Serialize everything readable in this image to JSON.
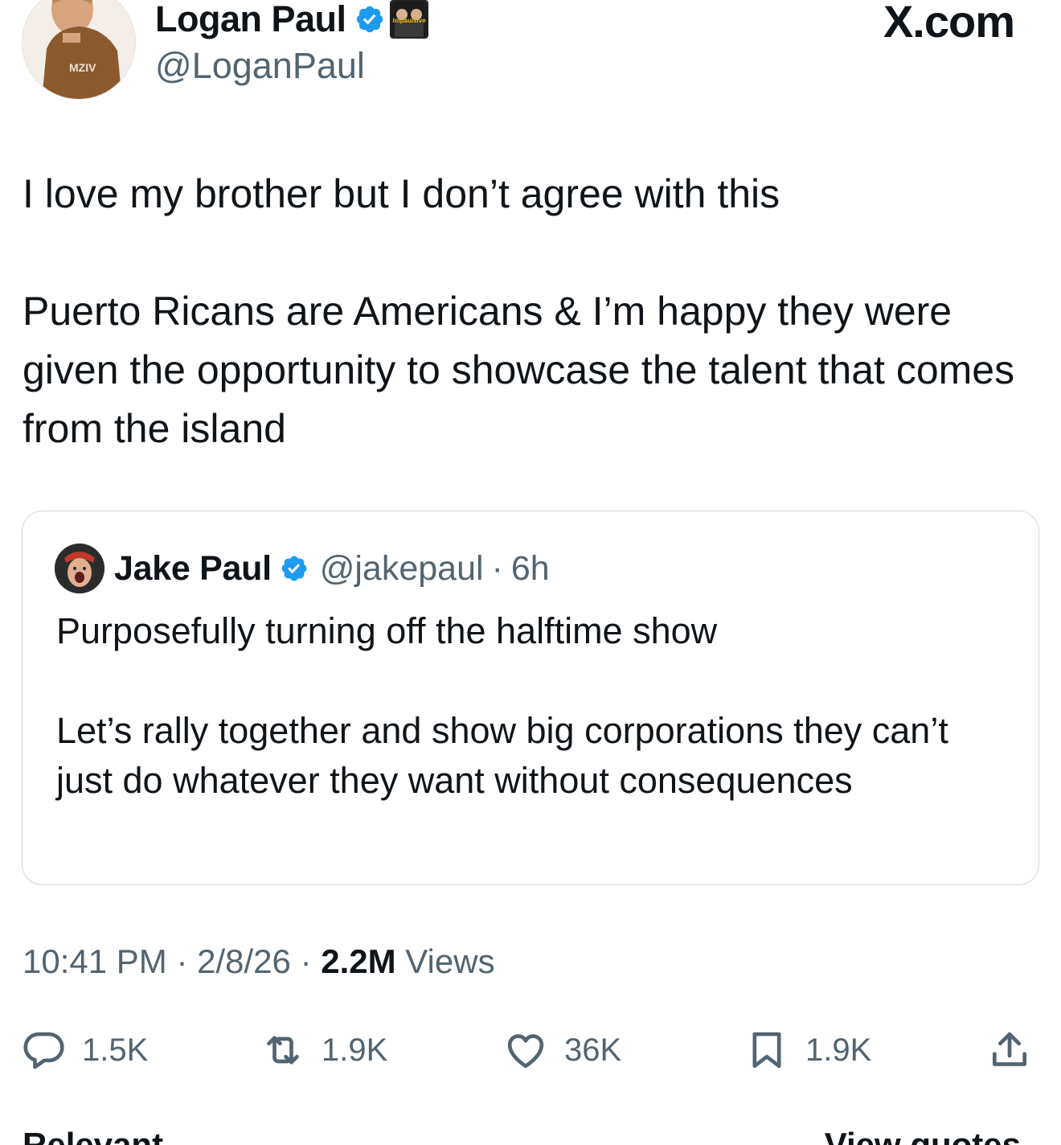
{
  "author": {
    "display_name": "Logan Paul",
    "handle": "@LoganPaul",
    "shirt_text": "MZIV",
    "affiliate_badge_text": "impaulsive"
  },
  "brand": "X.com",
  "tweet": {
    "paragraph_1": "I love my brother but I don’t agree with this",
    "paragraph_2": "Puerto Ricans are Americans & I’m happy they were given the opportunity to showcase the talent that comes from the island"
  },
  "quoted_tweet": {
    "display_name": "Jake Paul",
    "handle": "@jakepaul",
    "separator": "·",
    "time_ago": "6h",
    "paragraph_1": "Purposefully turning off the halftime show",
    "paragraph_2": "Let’s rally together and show big corporations they can’t just do whatever they want without consequences"
  },
  "meta": {
    "time": "10:41 PM",
    "separator": "·",
    "date": "2/8/26",
    "views_count": "2.2M",
    "views_label": "Views"
  },
  "actions": {
    "replies": "1.5K",
    "reposts": "1.9K",
    "likes": "36K",
    "bookmarks": "1.9K"
  },
  "bottom": {
    "left_label": "Relevant",
    "right_label": "View quotes"
  },
  "colors": {
    "verified_blue": "#1d9bf0",
    "text_primary": "#0f1419",
    "text_secondary": "#536471",
    "border": "#cfd9de"
  }
}
